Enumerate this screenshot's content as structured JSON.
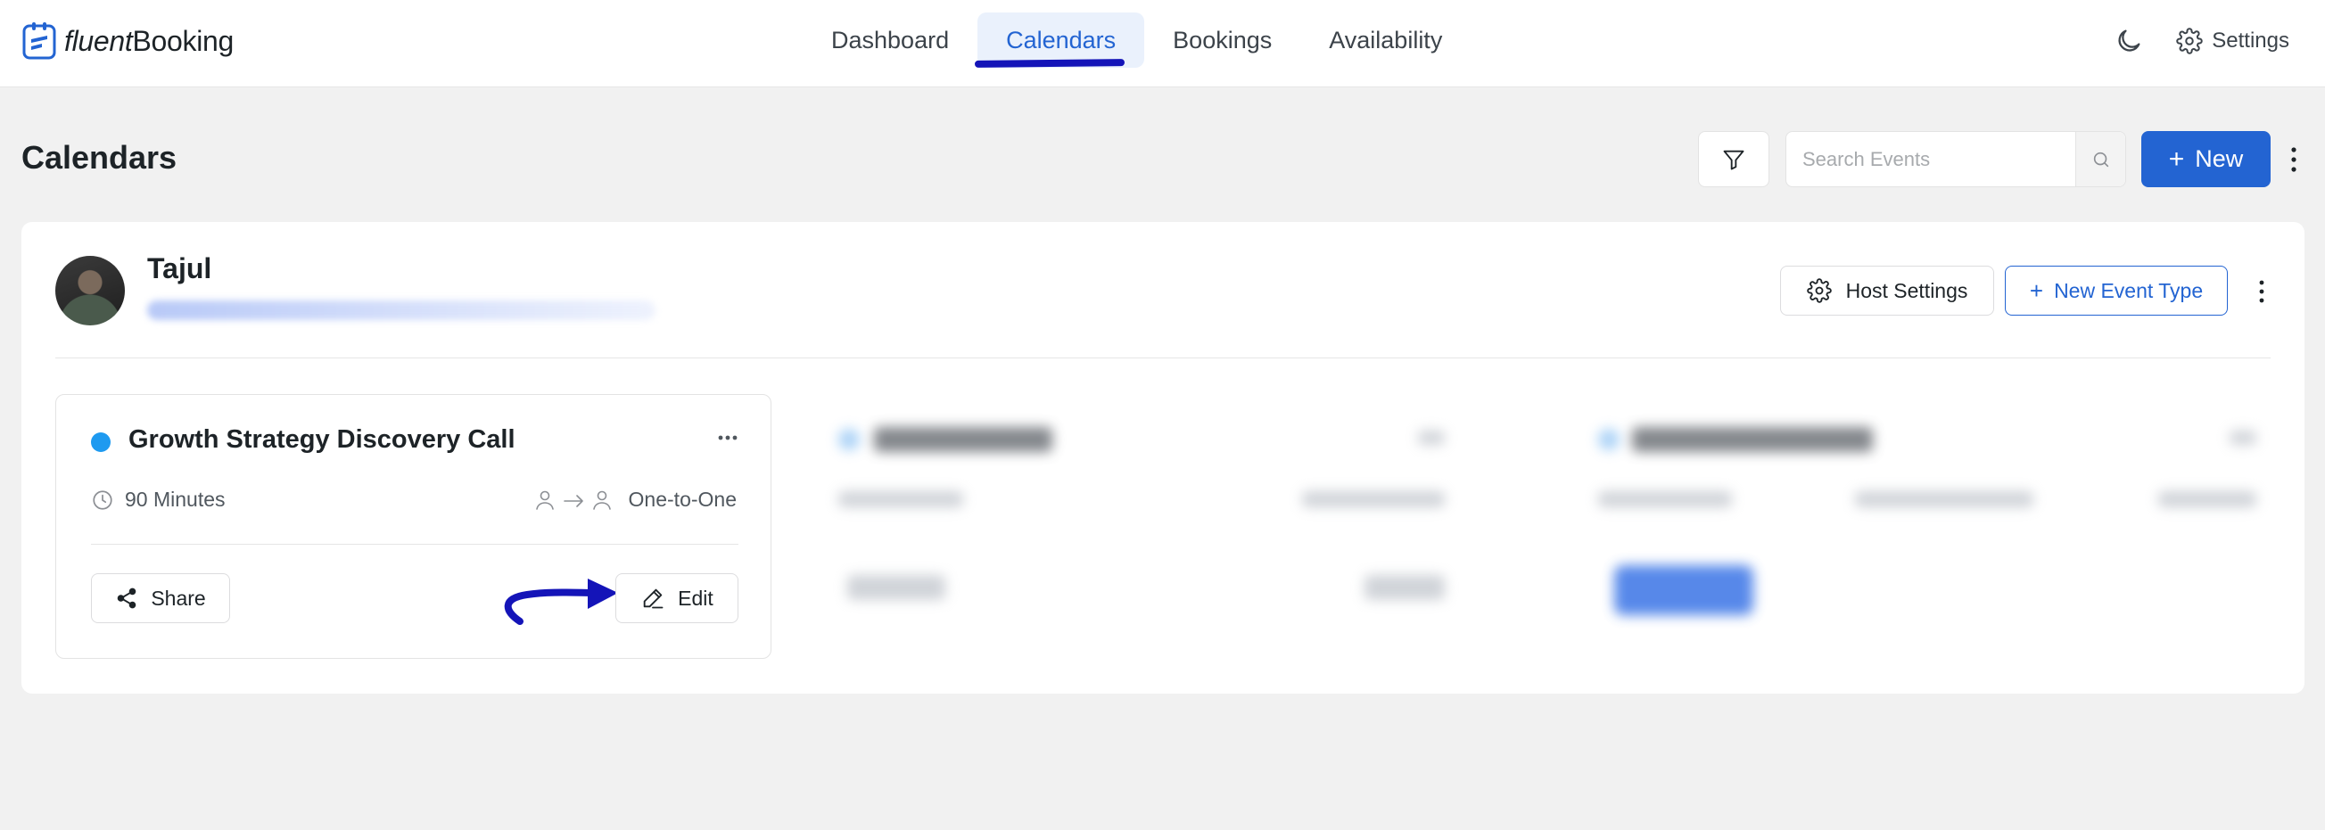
{
  "app": {
    "logo_fluent": "fluent",
    "logo_booking": "Booking"
  },
  "nav": {
    "items": [
      {
        "label": "Dashboard",
        "active": false
      },
      {
        "label": "Calendars",
        "active": true
      },
      {
        "label": "Bookings",
        "active": false
      },
      {
        "label": "Availability",
        "active": false
      }
    ]
  },
  "topbar": {
    "settings_label": "Settings",
    "theme_icon": "moon-icon",
    "settings_icon": "gear-icon"
  },
  "page": {
    "title": "Calendars",
    "search_placeholder": "Search Events",
    "new_label": "New"
  },
  "host": {
    "name": "Tajul",
    "host_settings_label": "Host Settings",
    "new_event_type_label": "New Event Type"
  },
  "event": {
    "title": "Growth Strategy Discovery Call",
    "duration": "90 Minutes",
    "meeting_type": "One-to-One",
    "share_label": "Share",
    "edit_label": "Edit",
    "dot_color": "#1e9af0"
  },
  "colors": {
    "accent": "#2364d2",
    "annotation": "#1414b8"
  }
}
